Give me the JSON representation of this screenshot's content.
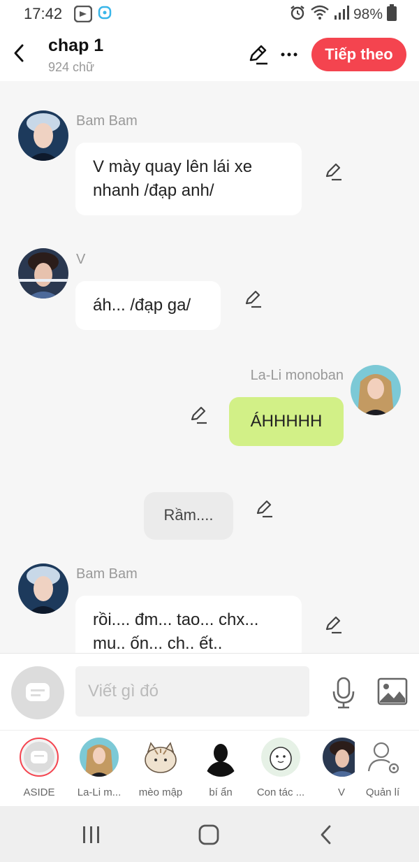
{
  "status": {
    "time": "17:42",
    "battery": "98%",
    "icons": [
      "video-app-icon",
      "messenger-app-icon",
      "alarm-icon",
      "wifi-icon",
      "signal-icon",
      "battery-icon"
    ]
  },
  "header": {
    "title": "chap 1",
    "word_count": "924 chữ",
    "next_label": "Tiếp theo",
    "accent": "#f4444f"
  },
  "messages": [
    {
      "sender": "Bam Bam",
      "text": "V mày quay lên lái xe nhanh /đạp anh/"
    },
    {
      "sender": "V",
      "text": "áh... /đạp ga/"
    },
    {
      "sender": "La-Li monoban",
      "text": "ÁHHHHH",
      "color": "#d2f087"
    },
    {
      "sender": "",
      "text": "Rầm...."
    },
    {
      "sender": "Bam Bam",
      "text": "rồi.... đm... tao... chx... mu.. ốn... ch.. ết.."
    }
  ],
  "composer": {
    "placeholder": "Viết gì đó"
  },
  "characters": [
    {
      "label": "ASIDE"
    },
    {
      "label": "La-Li m..."
    },
    {
      "label": "mèo mập"
    },
    {
      "label": "bí ẩn"
    },
    {
      "label": "Con tác ..."
    },
    {
      "label": "V"
    },
    {
      "label": "Quản lí"
    }
  ]
}
